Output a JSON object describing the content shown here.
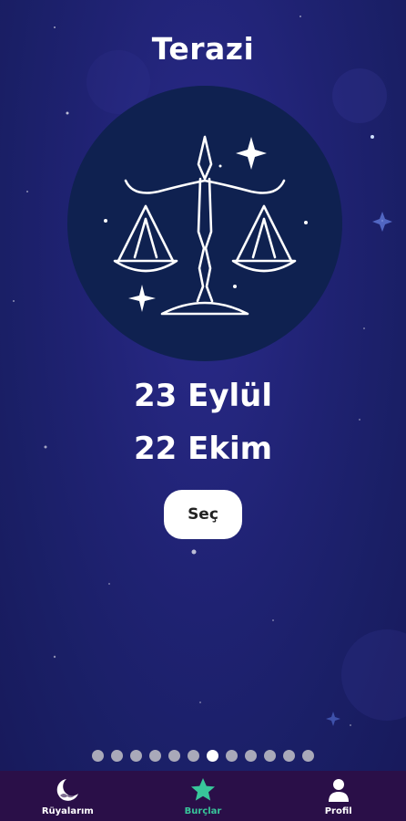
{
  "screen": {
    "title": "Terazi",
    "sign_icon": "libra-scales-icon",
    "date_start": "23 Eylül",
    "date_end": "22 Ekim",
    "select_label": "Seç"
  },
  "pager": {
    "total": 12,
    "active_index": 6
  },
  "bottom_nav": {
    "items": [
      {
        "label": "Rüyalarım",
        "icon": "moon-icon"
      },
      {
        "label": "Burçlar",
        "icon": "star-icon",
        "active": true
      },
      {
        "label": "Profil",
        "icon": "person-icon"
      }
    ]
  },
  "colors": {
    "nav_active": "#38c69a",
    "nav_bg": "#2a0f48",
    "circle_bg": "#0f2150"
  }
}
